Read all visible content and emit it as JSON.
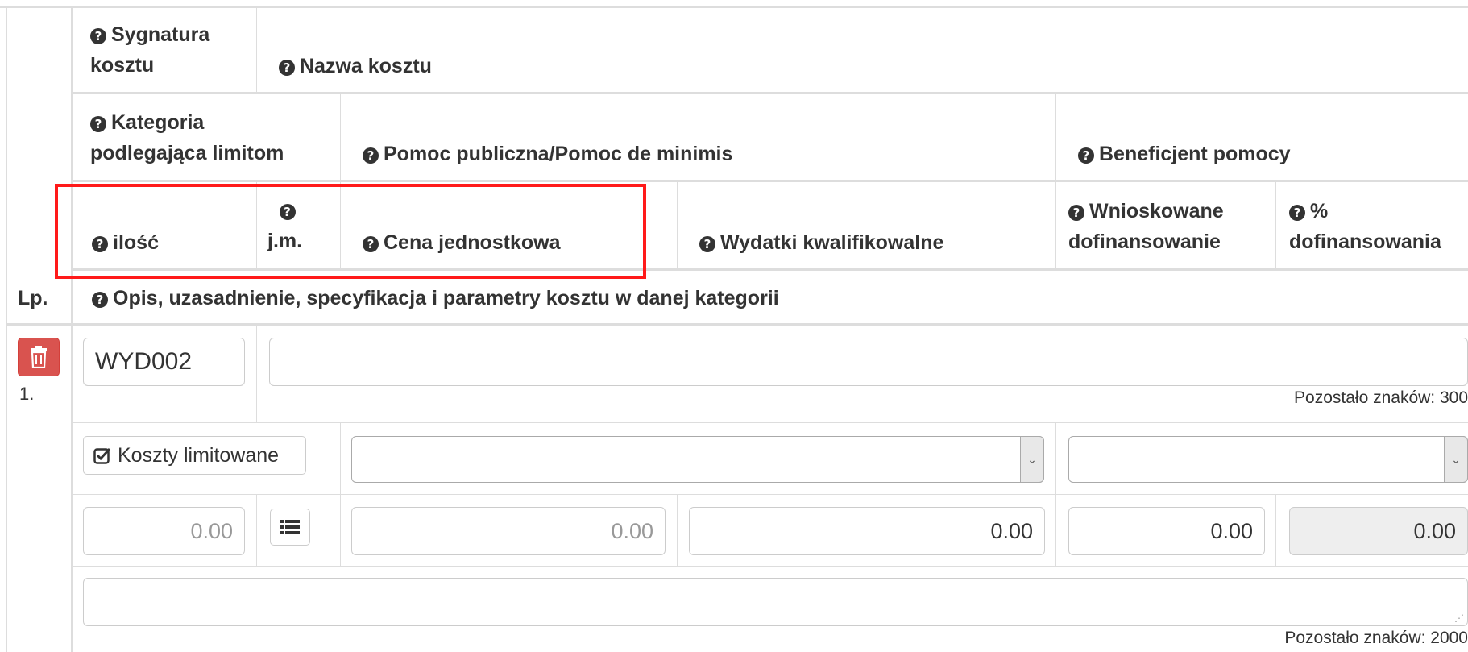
{
  "headers": {
    "sygnatura": "Sygnatura kosztu",
    "nazwa": "Nazwa kosztu",
    "kategoria": "Kategoria podlegająca limitom",
    "pomoc": "Pomoc publiczna/Pomoc de minimis",
    "beneficjent": "Beneficjent pomocy",
    "ilosc": "ilość",
    "jm": "j.m.",
    "cena": "Cena jednostkowa",
    "wydatki": "Wydatki kwalifikowalne",
    "wnioskowane": "Wnioskowane dofinansowanie",
    "procent": "% dofinansowania",
    "lp": "Lp.",
    "opis": "Opis, uzasadnienie, specyfikacja i parametry kosztu w danej kategorii"
  },
  "row": {
    "number": "1.",
    "sygnatura_value": "WYD002",
    "nazwa_value": "",
    "nazwa_remaining": "Pozostało znaków: 300",
    "koszty_button": "Koszty limitowane",
    "pomoc_select": "",
    "beneficjent_select": "",
    "ilosc_placeholder": "0.00",
    "cena_placeholder": "0.00",
    "wydatki_value": "0.00",
    "wnioskowane_value": "0.00",
    "procent_value": "0.00",
    "opis_value": "",
    "opis_remaining": "Pozostało znaków: 2000"
  },
  "colors": {
    "highlight": "#ff1a1a",
    "danger": "#d9534f",
    "border": "#dddddd"
  }
}
